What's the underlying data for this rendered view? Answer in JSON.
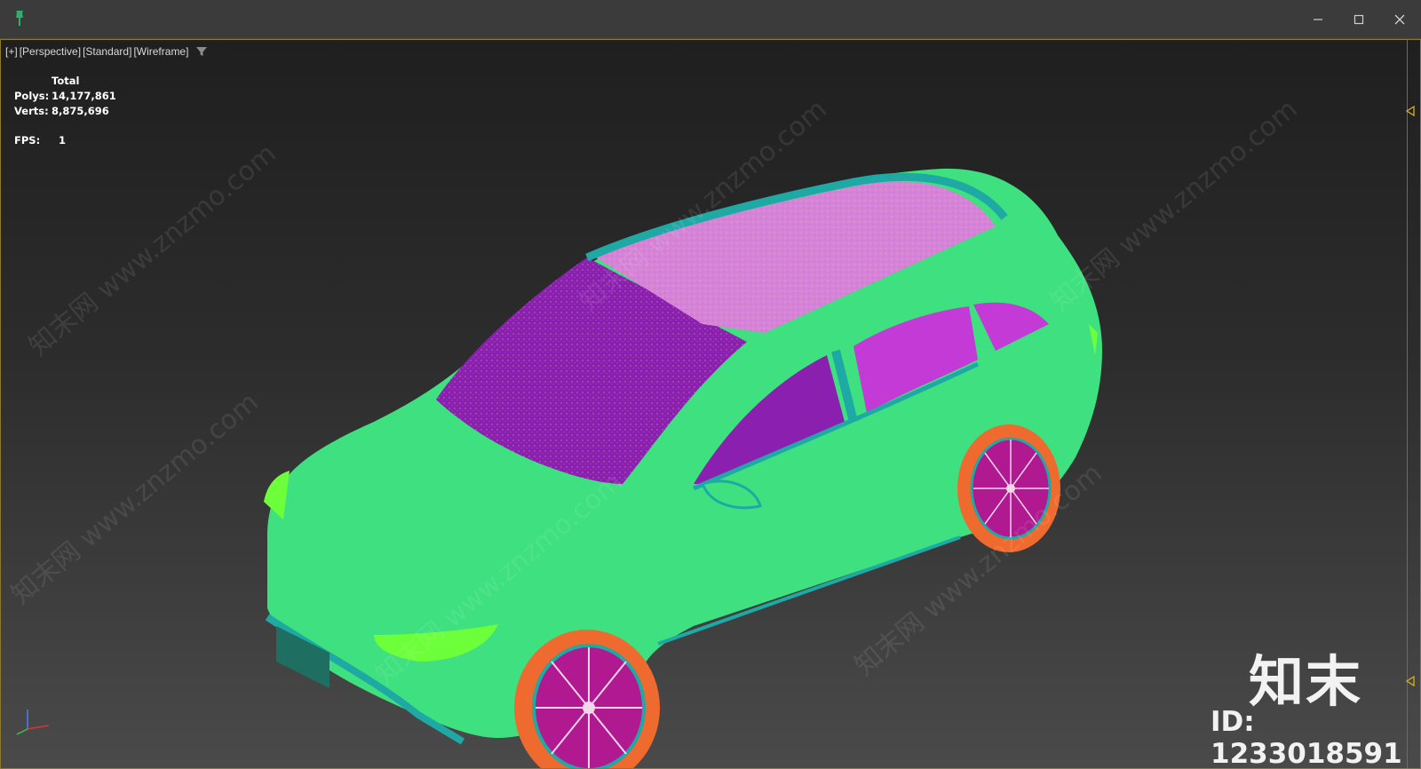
{
  "titlebar": {
    "icons": {
      "pin": "pin-icon",
      "minimize": "minimize-icon",
      "maximize": "maximize-icon",
      "close": "close-icon"
    }
  },
  "viewport": {
    "label": {
      "plus": "[+]",
      "view": "[Perspective]",
      "shading_mode": "[Standard]",
      "display": "[Wireframe]"
    },
    "filter_icon": "filter-icon",
    "stats": {
      "header": "Total",
      "polys_label": "Polys:",
      "polys_value": "14,177,861",
      "verts_label": "Verts:",
      "verts_value": "8,875,696",
      "fps_label": "FPS:",
      "fps_value": "1"
    },
    "gizmo_icon": "axis-gizmo-icon"
  },
  "watermark": {
    "text": "知末网 www.znzmo.com"
  },
  "brand": {
    "logo": "知末",
    "id_text": "ID: 1233018591"
  },
  "colors": {
    "body": "#3ee07f",
    "glass": "#8a1fb0",
    "glass_rear": "#c33ad6",
    "roof": "#d582d8",
    "trim": "#1fa9a5",
    "tire": "#ee6a2e",
    "rim": "#b0198f",
    "accent": "#8a7a2a"
  }
}
